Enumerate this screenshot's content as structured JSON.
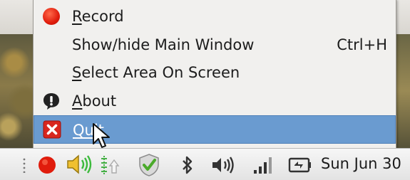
{
  "menu": {
    "items": [
      {
        "label_prefix": "",
        "label_underlined": "R",
        "label_rest": "ecord",
        "accelerator": "",
        "icon": "record-dot-icon",
        "selected": false
      },
      {
        "label_prefix": "Show/hide Main Window",
        "label_underlined": "",
        "label_rest": "",
        "accelerator": "Ctrl+H",
        "icon": "",
        "selected": false
      },
      {
        "label_prefix": "",
        "label_underlined": "S",
        "label_rest": "elect Area On Screen",
        "accelerator": "",
        "icon": "",
        "selected": false
      },
      {
        "label_prefix": "",
        "label_underlined": "A",
        "label_rest": "bout",
        "accelerator": "",
        "icon": "info-icon",
        "selected": false
      },
      {
        "label_prefix": "",
        "label_underlined": "Qu",
        "label_rest": "it",
        "accelerator": "",
        "icon": "quit-icon",
        "selected": true
      }
    ]
  },
  "panel": {
    "clock_text": "Sun Jun 30",
    "tray_icons": [
      "handle-grip-icon",
      "record-dot-icon",
      "volume-speaker-icon",
      "network-up-icon",
      "shield-check-icon",
      "bluetooth-icon",
      "volume-icon",
      "signal-bars-icon",
      "battery-icon"
    ]
  },
  "colors": {
    "menu_bg": "#f1f0ee",
    "selection": "#6a9bd0",
    "record_red": "#e01c0c"
  }
}
